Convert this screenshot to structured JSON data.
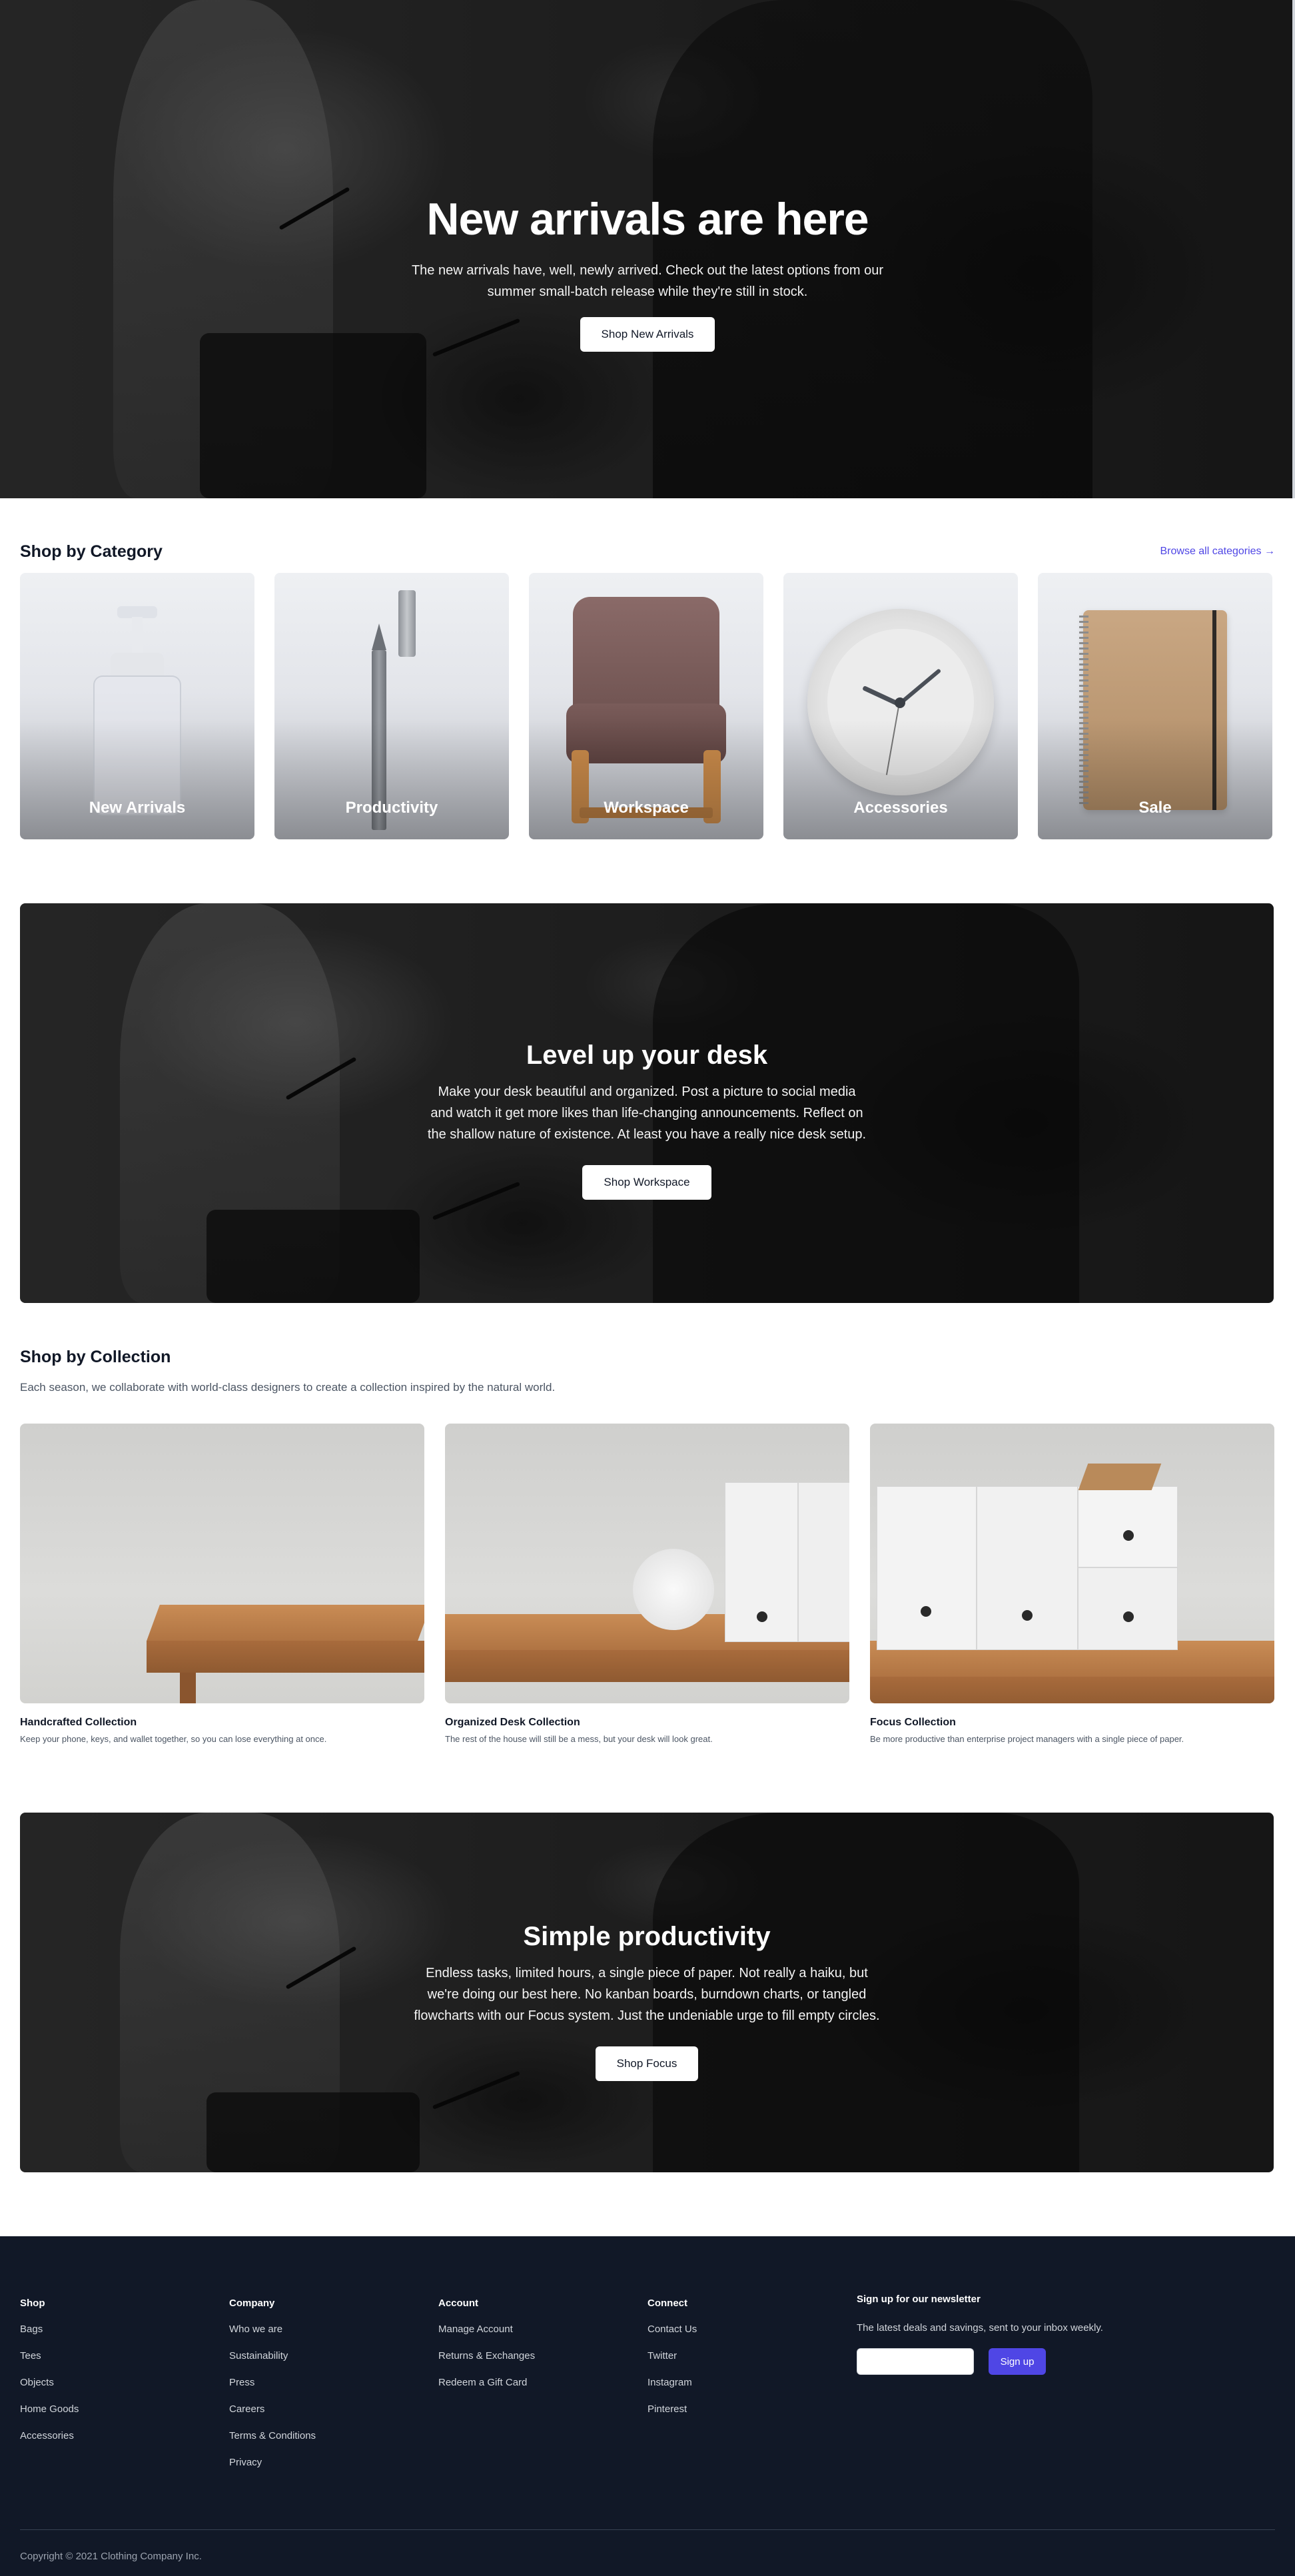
{
  "hero": {
    "title": "New arrivals are here",
    "subtitle": "The new arrivals have, well, newly arrived. Check out the latest options from our summer small-batch release while they're still in stock.",
    "button": "Shop New Arrivals"
  },
  "categories": {
    "title": "Shop by Category",
    "browse_link": "Browse all categories →",
    "items": [
      {
        "label": "New Arrivals",
        "icon": "soap-dispenser-icon"
      },
      {
        "label": "Productivity",
        "icon": "pen-icon"
      },
      {
        "label": "Workspace",
        "icon": "chair-icon"
      },
      {
        "label": "Accessories",
        "icon": "clock-icon"
      },
      {
        "label": "Sale",
        "icon": "notebook-icon"
      }
    ]
  },
  "workspace_banner": {
    "title": "Level up your desk",
    "text": "Make your desk beautiful and organized. Post a picture to social media and watch it get more likes than life-changing announcements. Reflect on the shallow nature of existence. At least you have a really nice desk setup.",
    "button": "Shop Workspace"
  },
  "collections": {
    "title": "Shop by Collection",
    "subtitle": "Each season, we collaborate with world-class designers to create a collection inspired by the natural world.",
    "items": [
      {
        "name": "Handcrafted Collection",
        "description": "Keep your phone, keys, and wallet together, so you can lose everything at once."
      },
      {
        "name": "Organized Desk Collection",
        "description": "The rest of the house will still be a mess, but your desk will look great."
      },
      {
        "name": "Focus Collection",
        "description": "Be more productive than enterprise project managers with a single piece of paper."
      }
    ]
  },
  "focus_banner": {
    "title": "Simple productivity",
    "text": "Endless tasks, limited hours, a single piece of paper. Not really a haiku, but we're doing our best here. No kanban boards, burndown charts, or tangled flowcharts with our Focus system. Just the undeniable urge to fill empty circles.",
    "button": "Shop Focus"
  },
  "footer": {
    "shop": {
      "heading": "Shop",
      "links": [
        "Bags",
        "Tees",
        "Objects",
        "Home Goods",
        "Accessories"
      ]
    },
    "company": {
      "heading": "Company",
      "links": [
        "Who we are",
        "Sustainability",
        "Press",
        "Careers",
        "Terms & Conditions",
        "Privacy"
      ]
    },
    "account": {
      "heading": "Account",
      "links": [
        "Manage Account",
        "Returns & Exchanges",
        "Redeem a Gift Card"
      ]
    },
    "connect": {
      "heading": "Connect",
      "links": [
        "Contact Us",
        "Twitter",
        "Instagram",
        "Pinterest"
      ]
    },
    "newsletter": {
      "heading": "Sign up for our newsletter",
      "text": "The latest deals and savings, sent to your inbox weekly.",
      "input_value": "",
      "button": "Sign up"
    },
    "copyright": "Copyright © 2021 Clothing Company Inc."
  },
  "colors": {
    "accent": "#4f46e5",
    "footer_bg": "#111827",
    "text_dark": "#111827",
    "text_muted": "#4b5563"
  }
}
